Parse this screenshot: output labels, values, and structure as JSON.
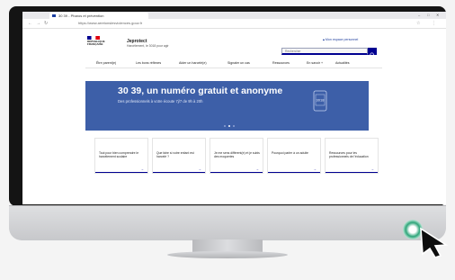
{
  "browser": {
    "tab_title": "30 39 - Pharos et prévention",
    "url": "https://www.arretonslesviolences.gouv.fr",
    "back_glyph": "←",
    "forward_glyph": "→",
    "reload_glyph": "↻",
    "minimize_glyph": "–",
    "maximize_glyph": "□",
    "close_glyph": "✕",
    "toolbar_icons": [
      "☆",
      "⋮"
    ]
  },
  "site": {
    "logo_lines": [
      "RÉPUBLIQUE",
      "FRANÇAISE"
    ],
    "name": "Jeprotect",
    "tagline": "Harcèlement, le 3018 pour agir",
    "account_link": "Mon espace personnel",
    "search_placeholder": "Rechercher",
    "nav": [
      "Être parent(e)",
      "Les bons réflexes",
      "Aider un harcelé(e)",
      "Signaler un cas",
      "Ressources",
      "En savoir +",
      "Actualités"
    ]
  },
  "banner": {
    "title": "30 39, un numéro gratuit et anonyme",
    "subtitle": "Des professionnels à votre écoute 7j/7 de 9h à 20h",
    "phone_number": "3018"
  },
  "cards": [
    {
      "text": "Tout pour bien comprendre le harcèlement scolaire",
      "arrow": "→"
    },
    {
      "text": "Que faire si votre enfant est harcelé ?",
      "arrow": "→"
    },
    {
      "text": "Je me sens différent(e) et je subis des moqueries",
      "arrow": "→"
    },
    {
      "text": "Pourquoi parler à un adulte",
      "arrow": "→"
    },
    {
      "text": "Ressources pour les professionnels de l'éducation",
      "arrow": "→"
    }
  ],
  "colors": {
    "accent": "#000091",
    "banner": "#3d5fa8",
    "power_light": "#2ea57a"
  }
}
